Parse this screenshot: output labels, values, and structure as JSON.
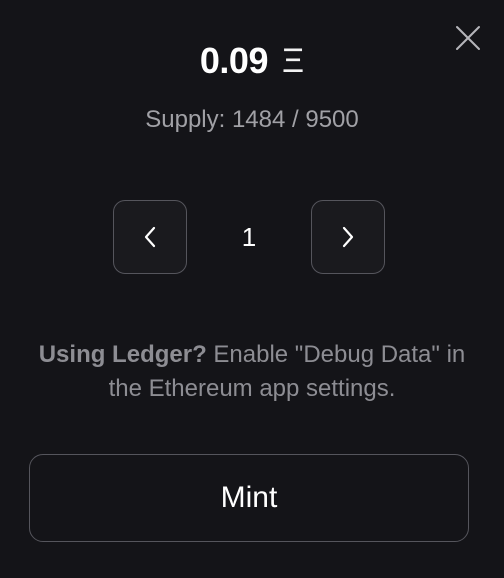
{
  "modal": {
    "price": "0.09",
    "currency_symbol": "Ξ",
    "supply_text": "Supply: 1484 / 9500",
    "quantity": "1",
    "ledger_bold": "Using Ledger?",
    "ledger_text": " Enable \"Debug Data\" in the Ethereum app settings.",
    "mint_label": "Mint"
  },
  "icons": {
    "close": "close-icon",
    "decrement": "chevron-left-icon",
    "increment": "chevron-right-icon"
  },
  "colors": {
    "background": "#141418",
    "border": "#55555c",
    "muted_text": "#8d8d93"
  }
}
